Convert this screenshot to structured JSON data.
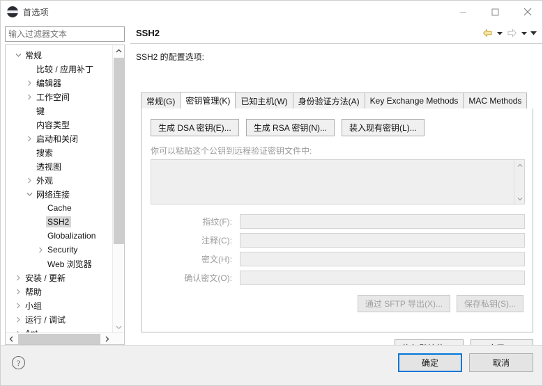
{
  "window": {
    "title": "首选项",
    "icon": "preferences-app-icon",
    "controls": {
      "minimize": "minimize",
      "maximize": "maximize",
      "close": "close"
    }
  },
  "sidebar": {
    "filter_placeholder": "输入过滤器文本",
    "filter_value": "",
    "items": [
      {
        "label": "常规",
        "level": 0,
        "state": "expanded",
        "selected": false
      },
      {
        "label": "比较 / 应用补丁",
        "level": 1,
        "state": "leaf",
        "selected": false
      },
      {
        "label": "编辑器",
        "level": 1,
        "state": "collapsed",
        "selected": false
      },
      {
        "label": "工作空间",
        "level": 1,
        "state": "collapsed",
        "selected": false
      },
      {
        "label": "键",
        "level": 1,
        "state": "leaf",
        "selected": false
      },
      {
        "label": "内容类型",
        "level": 1,
        "state": "leaf",
        "selected": false
      },
      {
        "label": "启动和关闭",
        "level": 1,
        "state": "collapsed",
        "selected": false
      },
      {
        "label": "搜索",
        "level": 1,
        "state": "leaf",
        "selected": false
      },
      {
        "label": "透视图",
        "level": 1,
        "state": "leaf",
        "selected": false
      },
      {
        "label": "外观",
        "level": 1,
        "state": "collapsed",
        "selected": false
      },
      {
        "label": "网络连接",
        "level": 1,
        "state": "expanded",
        "selected": false
      },
      {
        "label": "Cache",
        "level": 2,
        "state": "leaf",
        "selected": false
      },
      {
        "label": "SSH2",
        "level": 2,
        "state": "leaf",
        "selected": true
      },
      {
        "label": "Globalization",
        "level": 2,
        "state": "leaf",
        "selected": false
      },
      {
        "label": "Security",
        "level": 2,
        "state": "collapsed",
        "selected": false
      },
      {
        "label": "Web 浏览器",
        "level": 2,
        "state": "leaf",
        "selected": false
      },
      {
        "label": "安装 / 更新",
        "level": 0,
        "state": "collapsed",
        "selected": false
      },
      {
        "label": "帮助",
        "level": 0,
        "state": "collapsed",
        "selected": false
      },
      {
        "label": "小组",
        "level": 0,
        "state": "collapsed",
        "selected": false
      },
      {
        "label": "运行 / 调试",
        "level": 0,
        "state": "collapsed",
        "selected": false
      },
      {
        "label": "Ant",
        "level": 0,
        "state": "collapsed",
        "selected": false
      }
    ]
  },
  "content": {
    "title": "SSH2",
    "subtitle": "SSH2 的配置选项:",
    "nav": {
      "back": "back-arrow",
      "back_menu": "back-dropdown",
      "forward": "forward-arrow",
      "forward_menu": "forward-dropdown",
      "more": "view-menu"
    },
    "tabs": [
      {
        "label": "常规(G)",
        "active": false
      },
      {
        "label": "密钥管理(K)",
        "active": true
      },
      {
        "label": "已知主机(W)",
        "active": false
      },
      {
        "label": "身份验证方法(A)",
        "active": false
      },
      {
        "label": "Key Exchange Methods",
        "active": false
      },
      {
        "label": "MAC Methods",
        "active": false
      }
    ],
    "key_buttons": [
      {
        "label": "生成 DSA 密钥(E)...",
        "disabled": false
      },
      {
        "label": "生成 RSA 密钥(N)...",
        "disabled": false
      },
      {
        "label": "装入现有密钥(L)...",
        "disabled": false
      }
    ],
    "paste_note": "你可以粘贴这个公钥到远程验证密钥文件中:",
    "public_key_value": "",
    "fields": [
      {
        "label": "指纹(F):",
        "value": ""
      },
      {
        "label": "注释(C):",
        "value": ""
      },
      {
        "label": "密文(H):",
        "value": ""
      },
      {
        "label": "确认密文(O):",
        "value": ""
      }
    ],
    "export_buttons": [
      {
        "label": "通过 SFTP 导出(X)...",
        "disabled": true
      },
      {
        "label": "保存私钥(S)...",
        "disabled": true
      }
    ],
    "restore_defaults": "恢复默认值(D)",
    "apply": "应用(A)"
  },
  "footer": {
    "help_icon": "help-icon",
    "ok": "确定",
    "cancel": "取消"
  },
  "colors": {
    "accent": "#0078d7",
    "selection": "#d6d6d6",
    "back_arrow": "#e8c85a",
    "disabled_text": "#a0a0a0"
  }
}
